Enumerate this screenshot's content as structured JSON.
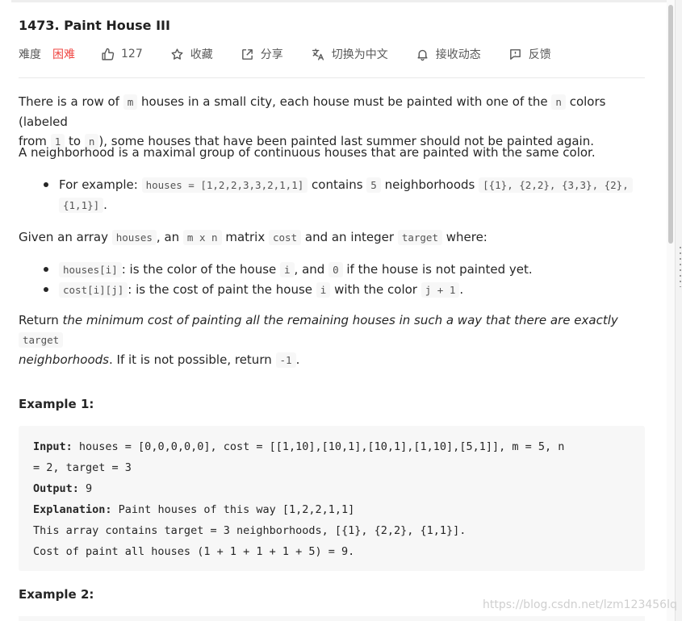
{
  "problem": {
    "title": "1473. Paint House III",
    "difficulty_label": "难度",
    "difficulty": "困难",
    "likes": "127",
    "favorite_label": "收藏",
    "share_label": "分享",
    "switch_cn_label": "切换为中文",
    "subscribe_label": "接收动态",
    "feedback_label": "反馈"
  },
  "description": {
    "p1": {
      "a": "There is a row of ",
      "c1": "m",
      "b": " houses in a small city, each house must be painted with one of the ",
      "c2": "n",
      "c": " colors (labeled",
      "d": "from ",
      "c3": "1",
      "e": " to ",
      "c4": "n",
      "f": "), some houses that have been painted last summer should not be painted again."
    },
    "p2": "A neighborhood is a maximal group of continuous houses that are painted with the same color.",
    "example_bullet": {
      "a": "For example: ",
      "c1": "houses = [1,2,2,3,3,2,1,1]",
      "b": " contains ",
      "c2": "5",
      "c": " neighborhoods ",
      "c3": "[{1}, {2,2}, {3,3}, {2},",
      "c4": "{1,1}]",
      "d": "."
    },
    "p3": {
      "a": "Given an array ",
      "c1": "houses",
      "b": ", an ",
      "c2": "m x n",
      "c": " matrix ",
      "c3": "cost",
      "d": " and an integer ",
      "c4": "target",
      "e": " where:"
    },
    "bullet1": {
      "c1": "houses[i]",
      "a": ": is the color of the house ",
      "c2": "i",
      "b": ", and ",
      "c3": "0",
      "c": " if the house is not painted yet."
    },
    "bullet2": {
      "c1": "cost[i][j]",
      "a": ": is the cost of paint the house ",
      "c2": "i",
      "b": " with the color ",
      "c3": "j + 1",
      "c": "."
    },
    "p4": {
      "a": "Return ",
      "em1": "the minimum cost of painting all the remaining houses in such a way that there are exactly",
      "c1": "target",
      "em2": "neighborhoods",
      "b": ". If it is not possible, return ",
      "c2": "-1",
      "c": "."
    }
  },
  "example1": {
    "title": "Example 1:",
    "input_label": "Input:",
    "input_1": " houses = [0,0,0,0,0], cost = [[1,10],[10,1],[10,1],[1,10],[5,1]], m = 5, n",
    "input_2": "= 2, target = 3",
    "output_label": "Output:",
    "output": " 9",
    "explanation_label": "Explanation:",
    "explanation": " Paint houses of this way [1,2,2,1,1]",
    "line5": "This array contains target = 3 neighborhoods, [{1}, {2,2}, {1,1}].",
    "line6": "Cost of paint all houses (1 + 1 + 1 + 1 + 5) = 9."
  },
  "example2": {
    "title": "Example 2:"
  },
  "watermark": "https://blog.csdn.net/lzm123456lq",
  "colors": {
    "difficulty_hard": "#ef4743",
    "code_bg": "#f7f7f7",
    "text": "#262626"
  }
}
